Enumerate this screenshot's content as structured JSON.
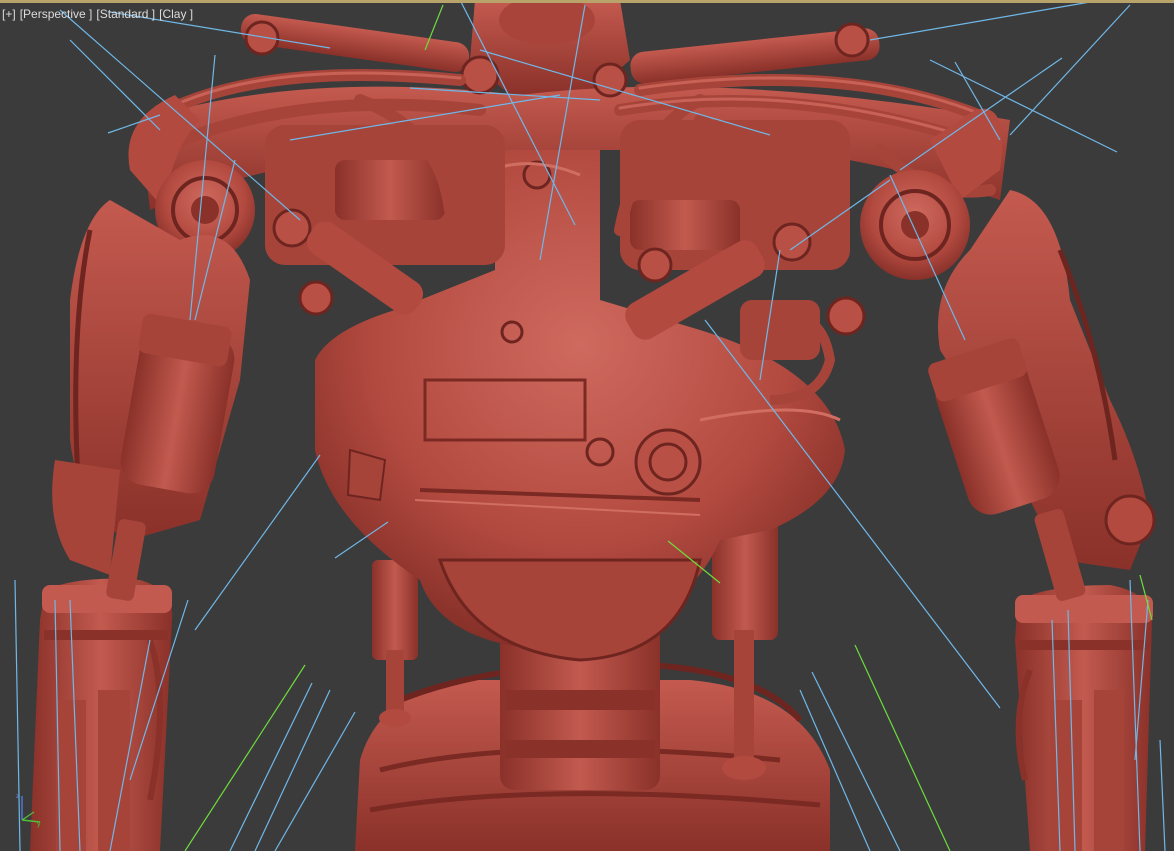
{
  "viewport": {
    "menus": {
      "plus": "[+]",
      "view": "[Perspective ]",
      "shading": "[Standard ]",
      "style": "[Clay ]"
    },
    "background_color": "#3b3b3b",
    "model_color": "#b34a40",
    "model_shadow_color": "#6e2520",
    "model_highlight_color": "#cf6a5f",
    "bone_line_color": "#6fb8e8",
    "helper_line_color": "#6edc3c",
    "frame_color": "#b8a46a"
  },
  "gizmo": {
    "icon": "axis-tripod-icon"
  }
}
